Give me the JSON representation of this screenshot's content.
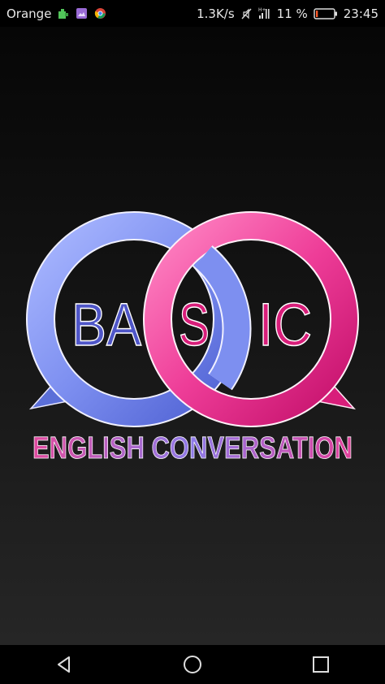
{
  "status_bar": {
    "carrier": "Orange",
    "network_speed": "1.3K/s",
    "battery_percent": "11 %",
    "battery_level": 0.11,
    "time": "23:45",
    "icons": [
      "puzzle-icon",
      "gallery-icon",
      "chrome-icon",
      "mute-icon",
      "signal-icon",
      "battery-icon"
    ]
  },
  "splash": {
    "logo_word_left": "BA",
    "logo_word_mid": "S",
    "logo_word_right": "IC",
    "tagline": "ENGLISH CONVERSATION",
    "colors": {
      "blue_ring": "#6f83e6",
      "pink_ring": "#ec2e8e",
      "text_blue": "#4f56c8",
      "text_pink": "#d81e7a"
    }
  },
  "nav_bar": {
    "buttons": [
      "back-icon",
      "home-icon",
      "recents-icon"
    ]
  }
}
